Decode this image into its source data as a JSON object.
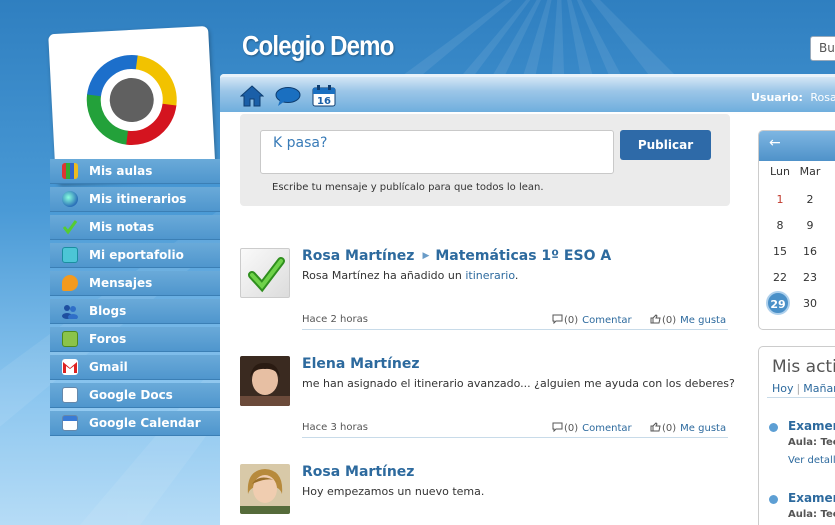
{
  "site": {
    "title": "Colegio Demo",
    "search_placeholder": "Bus"
  },
  "sidebar": {
    "items": [
      {
        "label": "Mis aulas",
        "icon": "books-icon"
      },
      {
        "label": "Mis itinerarios",
        "icon": "globe-icon"
      },
      {
        "label": "Mis notas",
        "icon": "checkmark-icon"
      },
      {
        "label": "Mi eportafolio",
        "icon": "briefcase-icon"
      },
      {
        "label": "Mensajes",
        "icon": "speech-bubble-icon"
      },
      {
        "label": "Blogs",
        "icon": "users-icon"
      },
      {
        "label": "Foros",
        "icon": "forum-icon"
      },
      {
        "label": "Gmail",
        "icon": "gmail-icon"
      },
      {
        "label": "Google Docs",
        "icon": "docs-icon"
      },
      {
        "label": "Google Calendar",
        "icon": "calendar-icon"
      }
    ]
  },
  "toolbar": {
    "user_label": "Usuario:",
    "user_name": "Rosa M"
  },
  "post_box": {
    "placeholder": "K pasa?",
    "publish_label": "Publicar",
    "hint": "Escribe tu mensaje y publícalo para que todos lo lean."
  },
  "feed": [
    {
      "author": "Rosa Martínez",
      "target": "Matemáticas 1º ESO A",
      "text_prefix": "Rosa Martínez ha añadido un ",
      "text_link": "itinerario",
      "text_suffix": ".",
      "time": "Hace 2 horas",
      "comments": "(0)",
      "comment_label": "Comentar",
      "likes": "(0)",
      "like_label": "Me gusta"
    },
    {
      "author": "Elena Martínez",
      "text": "me han asignado el itinerario avanzado... ¿alguien me ayuda con los deberes?",
      "time": "Hace 3 horas",
      "comments": "(0)",
      "comment_label": "Comentar",
      "likes": "(0)",
      "like_label": "Me gusta"
    },
    {
      "author": "Rosa Martínez",
      "text": "Hoy empezamos un nuevo tema."
    }
  ],
  "calendar": {
    "prev_arrow": "←",
    "day_headers": [
      "Lun",
      "Mar"
    ],
    "rows": [
      [
        "1",
        "2"
      ],
      [
        "8",
        "9"
      ],
      [
        "15",
        "16"
      ],
      [
        "22",
        "23"
      ],
      [
        "29",
        "30"
      ]
    ],
    "today": "29"
  },
  "activities": {
    "title": "Mis acti",
    "tab_today": "Hoy",
    "tab_tomorrow": "Mañan",
    "items": [
      {
        "title": "Examen",
        "subtitle": "Aula: Tec",
        "link": "Ver detall"
      },
      {
        "title": "Examen",
        "subtitle": "Aula: Tec"
      }
    ]
  },
  "colors": {
    "brand_blue": "#2e6aa8",
    "link_blue": "#2d6a9e",
    "sidebar_blue": "#4f96cd"
  }
}
